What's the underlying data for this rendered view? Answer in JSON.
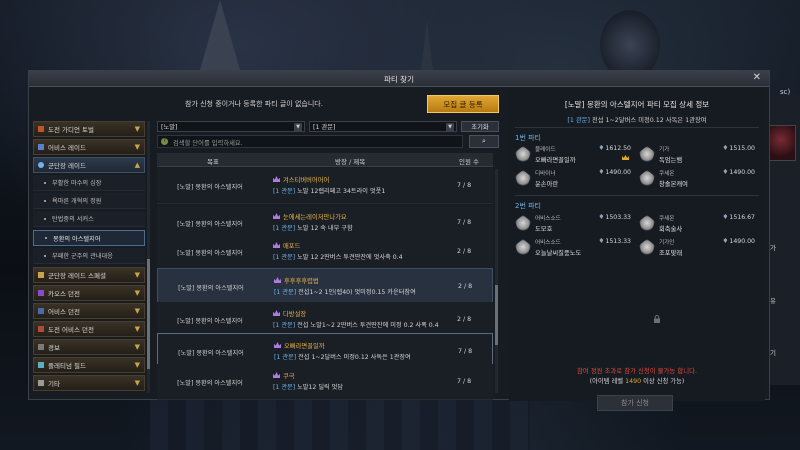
{
  "window": {
    "title": "파티 찾기",
    "close_label": "✕"
  },
  "side_ui": {
    "top_label": "sc)",
    "item1": "불가",
    "item2": "공유",
    "item3": "찾기"
  },
  "notice": "참가 신청 중이거나 등록한 파티 글이 없습니다.",
  "recruit_button": "모집 글 등록",
  "filters": {
    "difficulty": "[노말]",
    "gate": "[1 관문]",
    "reset": "초기화",
    "search_placeholder": "검색할 단어를 입력하세요.",
    "search_icon": "magnifier-icon"
  },
  "table": {
    "headers": {
      "target": "목표",
      "title": "방장 / 제목",
      "count": "인원 수"
    },
    "rows": [
      {
        "target": "[노말] 몽환의 아스텔지어",
        "leader": "겨스티버버어어어",
        "tag": "[1 관문]",
        "desc": " 노말 12렙리페고 34트라이 멋풋1",
        "count": "7 / 8"
      },
      {
        "target": "[노말] 몽환의 아스텔지어",
        "leader": "눈에세는레이저만나가요",
        "tag": "[1 관문]",
        "desc": " 노말 12 숙 내부 구함",
        "count": "7 / 8"
      },
      {
        "target": "[노말] 몽환의 아스텔지어",
        "leader": "매포드",
        "tag": "[1 관문]",
        "desc": " 노말 12 2딴버스 투견딴잔에 멋사축 0.4",
        "count": "2 / 8"
      },
      {
        "target": "[노말] 몽환의 아스텔지어",
        "leader": "후후후후렵법",
        "tag": "[1 관문]",
        "desc": " 전섭1~2 1인(렙40) 멋미정0.15  카운터참여",
        "count": "2 / 8"
      },
      {
        "target": "[노말] 몽환의 아스텔지어",
        "leader": "다방설장",
        "tag": "[1 관문]",
        "desc": " 전섭 노말1~2 2딴버스 투견딴잔에 미정 0.2 사폭 0.4",
        "count": "2 / 8"
      },
      {
        "target": "[노말] 몽환의 아스텔지어",
        "leader": "오빠라면꼴일까",
        "tag": "[1 관문]",
        "desc": " 전섭 1~2달버스 미정0.12 사독은 1관장여",
        "count": "7 / 8"
      },
      {
        "target": "[노말] 몽환의 아스텔지어",
        "leader": "쿠극",
        "tag": "[1 관문]",
        "desc": " 노말12 딜릭 멋담",
        "count": "7 / 8"
      }
    ]
  },
  "sidebar": {
    "items": [
      {
        "label": "도전 가디언 토벌",
        "chevron": "▼"
      },
      {
        "label": "어비스 레이드",
        "chevron": "▼"
      },
      {
        "label": "군단장 레이드",
        "chevron": "▲"
      }
    ],
    "subitems": [
      "부활한 마수의 심장",
      "욕마른 개혁의 정원",
      "탄법중의 서커스",
      "몽환의 아스텔지어",
      "부패한 군주의 관내대응"
    ],
    "items2": [
      {
        "label": "군단장 레이드 스페셜",
        "chevron": "▼"
      },
      {
        "label": "카오스 던전",
        "chevron": "▼"
      },
      {
        "label": "어비스 던전",
        "chevron": "▼"
      },
      {
        "label": "도전 어비스 던전",
        "chevron": "▼"
      },
      {
        "label": "경보",
        "chevron": "▼"
      },
      {
        "label": "플레티넘 필드",
        "chevron": "▼"
      },
      {
        "label": "기타",
        "chevron": "▼"
      }
    ]
  },
  "detail": {
    "title": "[노말] 몽환의 아스텔지어 파티 모집 상세 정보",
    "sub_tag": "[1 관문]",
    "sub_text": " 전섭 1~2달버스 미정0.12 사독은 1관장여",
    "party1_label": "1번 파티",
    "party2_label": "2번 파티",
    "party1": [
      {
        "cls": "블레이드",
        "name": "오빠라면꼴일까",
        "lvl": "1612.50",
        "leader": true
      },
      {
        "cls": "디바이너",
        "name": "윤손아란",
        "lvl": "1490.00",
        "leader": false
      },
      {
        "cls": "기가",
        "name": "독엄는뱀",
        "lvl": "1515.00",
        "leader": false
      },
      {
        "cls": "쿠세온",
        "name": "창솔본캐여",
        "lvl": "1490.00",
        "leader": false
      }
    ],
    "party2": [
      {
        "cls": "어비스소드",
        "name": "도모호",
        "lvl": "1503.33",
        "leader": false
      },
      {
        "cls": "어비스소드",
        "name": "오늘날씨질풍노도",
        "lvl": "1513.33",
        "leader": false
      },
      {
        "cls": "쿠세온",
        "name": "회축술사",
        "lvl": "1516.67",
        "leader": false
      },
      {
        "cls": "기가인",
        "name": "조포맞래",
        "lvl": "1490.00",
        "leader": false
      }
    ],
    "warning": "참여 정원 초과로 참가 신청이 불가능 합니다.",
    "req_prefix": "(아이템 레벨 ",
    "req_level": "1490",
    "req_suffix": " 이상 신청 가능)",
    "apply_button": "참가 신청"
  },
  "colors": {
    "accent_gold": "#e0a92c",
    "accent_blue": "#6fb3e8",
    "warning_red": "#e04a3a"
  }
}
